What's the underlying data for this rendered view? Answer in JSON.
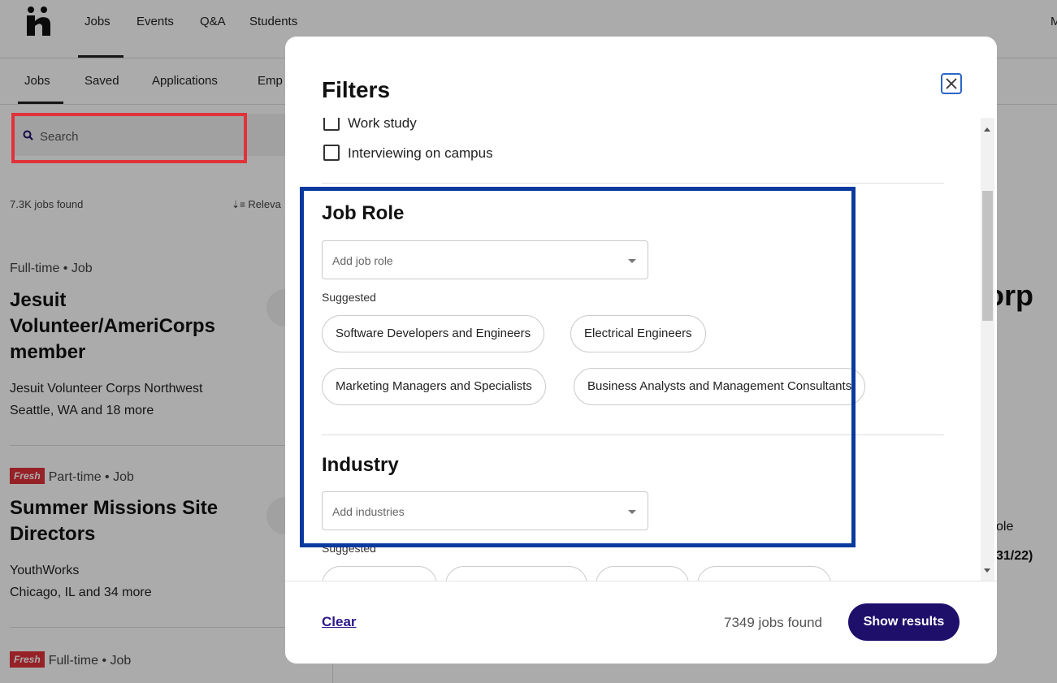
{
  "nav": {
    "links": [
      "Jobs",
      "Events",
      "Q&A",
      "Students"
    ],
    "right_initial": "M"
  },
  "subnav": {
    "links": [
      "Jobs",
      "Saved",
      "Applications",
      "Emp"
    ]
  },
  "search": {
    "placeholder": "Search"
  },
  "results": {
    "count": "7.3K jobs found",
    "sort": "Releva"
  },
  "jobs": [
    {
      "meta": "Full-time • Job",
      "fresh": "",
      "title": "Jesuit Volunteer/AmeriCorps member",
      "company": "Jesuit Volunteer Corps Northwest",
      "location": "Seattle, WA and 18 more"
    },
    {
      "meta": "Part-time • Job",
      "fresh": "Fresh",
      "title": "Summer Missions Site Directors",
      "company": "YouthWorks",
      "location": "Chicago, IL and 34 more"
    },
    {
      "meta": "Full-time • Job",
      "fresh": "Fresh",
      "title": "",
      "company": "",
      "location": ""
    }
  ],
  "right_panel": {
    "fragments": [
      "orp",
      "ole",
      "31/22)"
    ]
  },
  "modal": {
    "title": "Filters",
    "checkboxes": [
      "Work study",
      "Interviewing on campus"
    ],
    "job_role": {
      "title": "Job Role",
      "placeholder": "Add job role",
      "suggested_label": "Suggested",
      "chips": [
        "Software Developers and Engineers",
        "Electrical Engineers",
        "Marketing Managers and Specialists",
        "Business Analysts and Management Consultants"
      ]
    },
    "industry": {
      "title": "Industry",
      "placeholder": "Add industries",
      "suggested_label": "Suggested"
    },
    "footer": {
      "clear_label": "Clear",
      "count": "7349 jobs found",
      "show_label": "Show results"
    }
  },
  "colors": {
    "accent": "#1e0f6b",
    "fresh_badge": "#e0323b",
    "highlight_red": "#e0323b",
    "highlight_blue": "#0a3a9e"
  }
}
